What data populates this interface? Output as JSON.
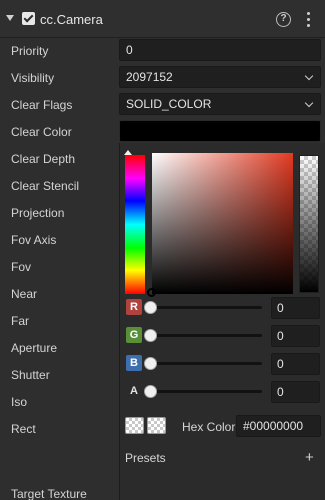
{
  "component": {
    "title": "cc.Camera",
    "help_icon": "help-circle-icon",
    "help_glyph": "?",
    "menu_icon": "more-vertical-icon"
  },
  "properties": {
    "priority": {
      "label": "Priority",
      "value": "0"
    },
    "visibility": {
      "label": "Visibility",
      "value": "2097152"
    },
    "clear_flags": {
      "label": "Clear Flags",
      "value": "SOLID_COLOR"
    },
    "clear_color": {
      "label": "Clear Color",
      "value": "#00000000"
    },
    "clear_depth": {
      "label": "Clear Depth"
    },
    "clear_stencil": {
      "label": "Clear Stencil"
    },
    "projection": {
      "label": "Projection"
    },
    "fov_axis": {
      "label": "Fov Axis"
    },
    "fov": {
      "label": "Fov"
    },
    "near": {
      "label": "Near"
    },
    "far": {
      "label": "Far"
    },
    "aperture": {
      "label": "Aperture"
    },
    "shutter": {
      "label": "Shutter"
    },
    "iso": {
      "label": "Iso"
    },
    "rect": {
      "label": "Rect"
    },
    "target_texture": {
      "label": "Target Texture"
    }
  },
  "color_picker": {
    "hue_color": "#e23a22",
    "channels": {
      "r": {
        "label": "R",
        "value": "0",
        "color": "#b0433e"
      },
      "g": {
        "label": "G",
        "value": "0",
        "color": "#5a8f3a"
      },
      "b": {
        "label": "B",
        "value": "0",
        "color": "#3d6fae"
      },
      "a": {
        "label": "A",
        "value": "0"
      }
    },
    "hex_label": "Hex Color",
    "hex_value": "#00000000",
    "presets_label": "Presets",
    "add_glyph": "+"
  }
}
